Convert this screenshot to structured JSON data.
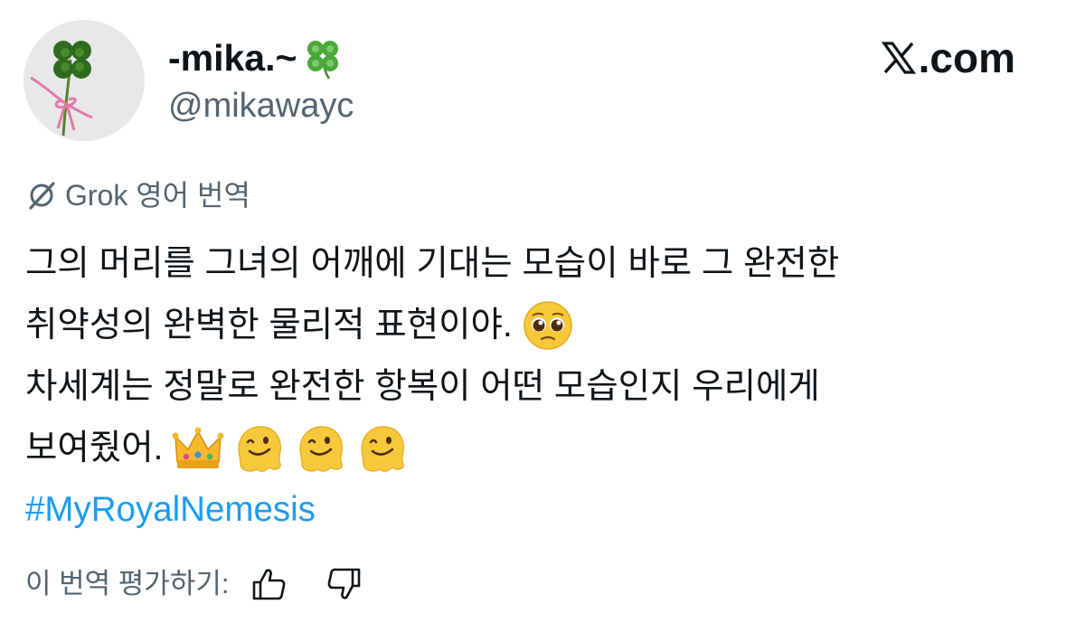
{
  "author": {
    "display_name": "-mika.~",
    "name_emoji": "four-leaf-clover-emoji",
    "handle": "@mikawayc",
    "avatar": "four-leaf-clover-photo"
  },
  "brand": {
    "text": ".com",
    "logo": "x-logo-icon"
  },
  "translation": {
    "icon": "grok-icon",
    "label": "Grok 영어 번역"
  },
  "tweet": {
    "lines": [
      "그의 머리를 그녀의 어깨에 기대는 모습이 바로 그 완전한",
      "취약성의 완벽한 물리적 표현이야.",
      "차세계는 정말로 완전한 항복이 어떤 모습인지 우리에게",
      "보여줬어."
    ],
    "emojis": {
      "line2": [
        "pleading-face-emoji"
      ],
      "line4": [
        "crown-emoji",
        "melting-face-emoji",
        "melting-face-emoji",
        "melting-face-emoji"
      ]
    },
    "hashtag": "#MyRoyalNemesis"
  },
  "rating": {
    "label": "이 번역 평가하기:",
    "up_icon": "thumbs-up-icon",
    "down_icon": "thumbs-down-icon"
  },
  "colors": {
    "text": "#0f1419",
    "secondary": "#536471",
    "link": "#1d9bf0"
  }
}
